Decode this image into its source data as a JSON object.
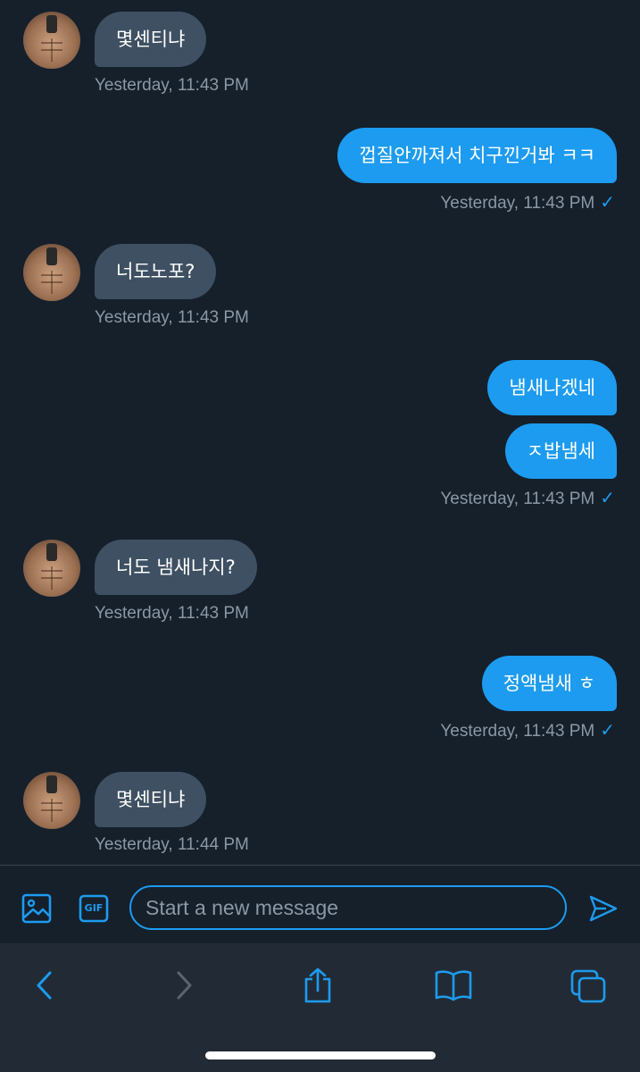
{
  "messages": [
    {
      "dir": "in",
      "text": "몇센티냐",
      "time": "Yesterday, 11:43 PM"
    },
    {
      "dir": "out",
      "text": "껍질안까져서 치구낀거봐 ㅋㅋ",
      "time": "Yesterday, 11:43 PM"
    },
    {
      "dir": "in",
      "text": "너도노포?",
      "time": "Yesterday, 11:43 PM"
    },
    {
      "dir": "out",
      "text": "냄새나겠네"
    },
    {
      "dir": "out",
      "text": "ㅈ밥냄세",
      "time": "Yesterday, 11:43 PM"
    },
    {
      "dir": "in",
      "text": "너도 냄새나지?",
      "time": "Yesterday, 11:43 PM"
    },
    {
      "dir": "out",
      "text": "정액냄새 ㅎ",
      "time": "Yesterday, 11:43 PM"
    },
    {
      "dir": "in",
      "text": "몇센티냐",
      "time": "Yesterday, 11:44 PM"
    }
  ],
  "read_check": "✓",
  "composer": {
    "placeholder": "Start a new message",
    "image_icon": "image-icon",
    "gif_icon": "gif-icon",
    "gif_label": "GIF",
    "send_icon": "send-icon"
  },
  "toolbar": {
    "icons": [
      "back-icon",
      "forward-icon",
      "share-icon",
      "bookmarks-icon",
      "tabs-icon"
    ]
  },
  "colors": {
    "background": "#15202b",
    "incoming_bubble": "#3e5062",
    "outgoing_bubble": "#1d9bf0",
    "timestamp": "#8b98a5",
    "accent": "#1d9bf0",
    "toolbar": "#222b35"
  }
}
